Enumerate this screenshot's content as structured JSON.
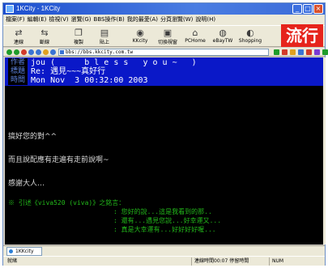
{
  "window": {
    "title": "1KCity - 1KCity",
    "controls": [
      "_",
      "□",
      "×"
    ]
  },
  "menubar": {
    "items": [
      "檔案(F)",
      "編輯(E)",
      "檢視(V)",
      "瀏覽(G)",
      "BBS操作(B)",
      "我的最愛(A)",
      "分頁瀏覽(W)",
      "說明(H)"
    ]
  },
  "toolbar": {
    "buttons": [
      {
        "label": "連線",
        "icon": "connect-icon"
      },
      {
        "label": "斷線",
        "icon": "disconnect-icon"
      },
      {
        "label": "複製",
        "icon": "copy-icon"
      },
      {
        "label": "貼上",
        "icon": "paste-icon"
      },
      {
        "label": "KKcity",
        "icon": "kkcity-icon"
      },
      {
        "label": "切換視窗",
        "icon": "switch-window-icon"
      },
      {
        "label": "PCHome",
        "icon": "pchome-icon"
      },
      {
        "label": "eBayTW",
        "icon": "ebay-icon"
      },
      {
        "label": "Shopping",
        "icon": "shopping-icon"
      }
    ],
    "brand": "流行"
  },
  "address": {
    "value": "bbs://bbs.kkcity.com.tw"
  },
  "article": {
    "author_label": "作者",
    "title_label": "標題",
    "time_label": "時間",
    "author_value": "jou (      b l e s s   y o u ~   )",
    "title_value": "Re: 遇見~~~真好行",
    "time_value": "Mon Nov  3 00:32:00 2003",
    "lines": [
      "搞好您的對^^",
      "而且說配應有走遍有走前說啊~",
      "感謝大人…"
    ],
    "quote_lines": [
      "※ 引述《viva520 (viva)》之銘言：",
      "                           : 您好的說...這是我看到的那..",
      "                           : 還有...遇見您說...好幸運又...",
      "                           : 真是大幸運有...好好好好喔..."
    ]
  },
  "tabbar": {
    "tab_label": "1KKcity"
  },
  "statusbar": {
    "left": "就緒",
    "middle": "連線時間00:07  停留時間",
    "right": "NUM"
  }
}
